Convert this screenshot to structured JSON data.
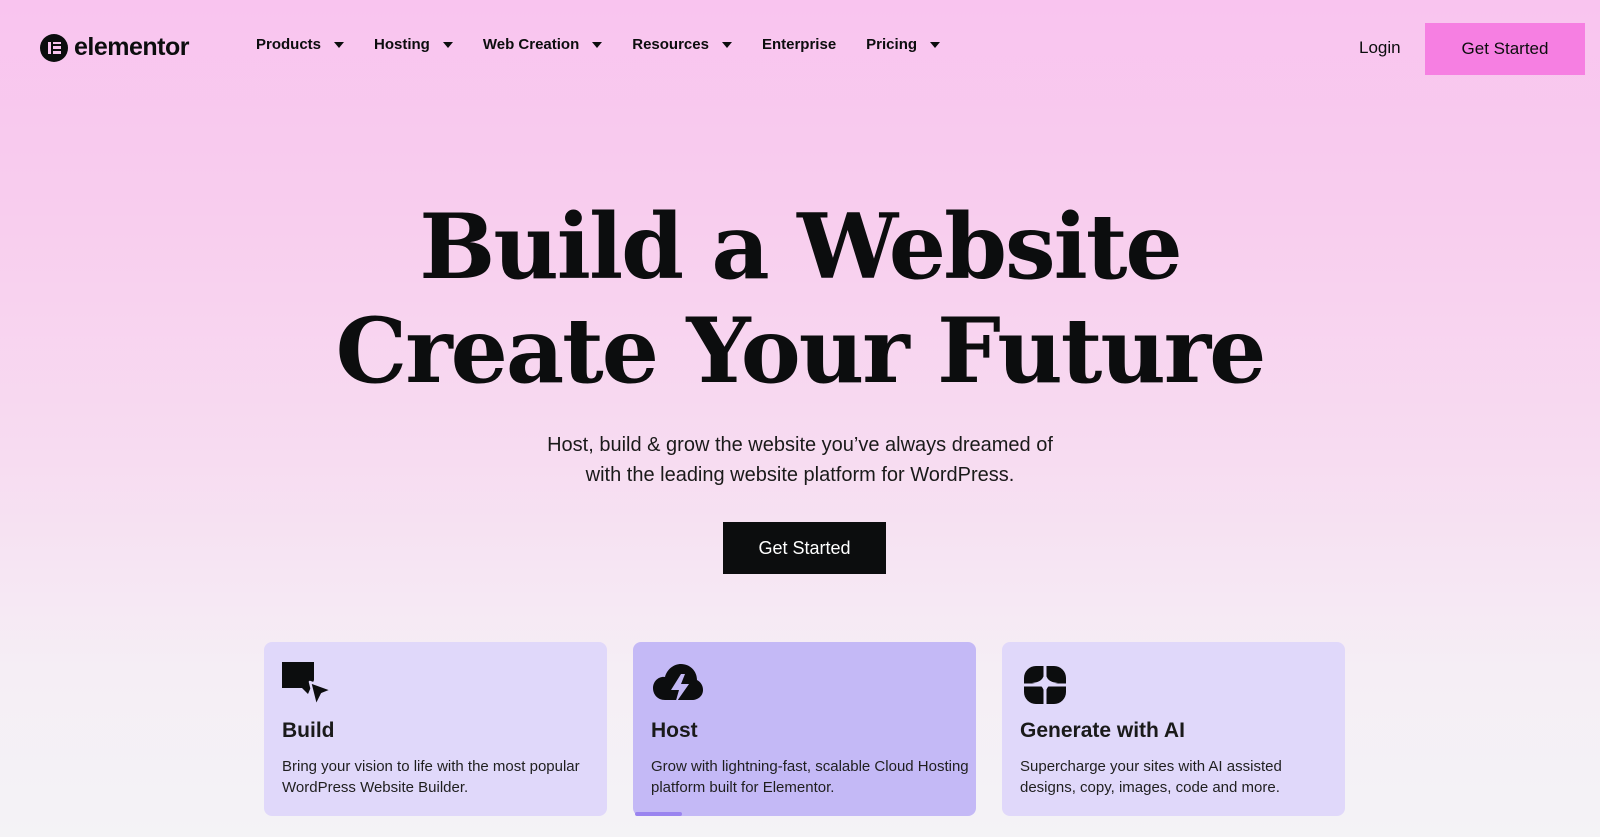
{
  "brand": {
    "name": "elementor",
    "accent": "#f67fe2",
    "dark": "#0c0d0e"
  },
  "nav": {
    "items": [
      {
        "label": "Products",
        "has_dropdown": true
      },
      {
        "label": "Hosting",
        "has_dropdown": true
      },
      {
        "label": "Web Creation",
        "has_dropdown": true
      },
      {
        "label": "Resources",
        "has_dropdown": true
      },
      {
        "label": "Enterprise",
        "has_dropdown": false
      },
      {
        "label": "Pricing",
        "has_dropdown": true
      }
    ],
    "login": "Login",
    "cta": "Get Started"
  },
  "hero": {
    "title_line1": "Build a Website",
    "title_line2": "Create Your Future",
    "subtitle_line1": "Host, build & grow the website you’ve always dreamed of",
    "subtitle_line2": "with the leading website platform for WordPress.",
    "cta": "Get Started"
  },
  "cards": [
    {
      "icon": "cursor-icon",
      "title": "Build",
      "desc": "Bring your vision to life with the most popular WordPress Website Builder.",
      "active": false
    },
    {
      "icon": "cloud-bolt-icon",
      "title": "Host",
      "desc": "Grow with lightning-fast, scalable Cloud Hosting platform built for Elementor.",
      "active": true,
      "progress": 0.14
    },
    {
      "icon": "ai-sparkle-icon",
      "title": "Generate with AI",
      "desc": "Supercharge your sites with AI assisted designs, copy, images, code and more.",
      "active": false
    }
  ]
}
